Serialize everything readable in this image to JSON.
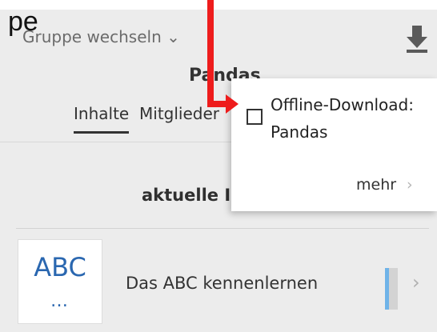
{
  "overlay_text": "pe",
  "header": {
    "group_switch": "Gruppe wechseln ⌄",
    "group_title": "Pandas",
    "tabs": [
      "Inhalte",
      "Mitglieder"
    ]
  },
  "section": {
    "title": "aktuelle Inhalte"
  },
  "list": {
    "items": [
      {
        "thumb_text": "ABC",
        "thumb_dots": "…",
        "title": "Das ABC kennenlernen",
        "progress": 0.3
      }
    ]
  },
  "popup": {
    "checkbox_label": "Offline-Download: Pandas",
    "more_label": "mehr",
    "more_chevron": "›"
  },
  "icons": {
    "download": "download-arrow-icon",
    "chevron_right": "›"
  },
  "colors": {
    "accent_blue": "#2a67b0",
    "annotation_red": "#ee1c1c"
  }
}
